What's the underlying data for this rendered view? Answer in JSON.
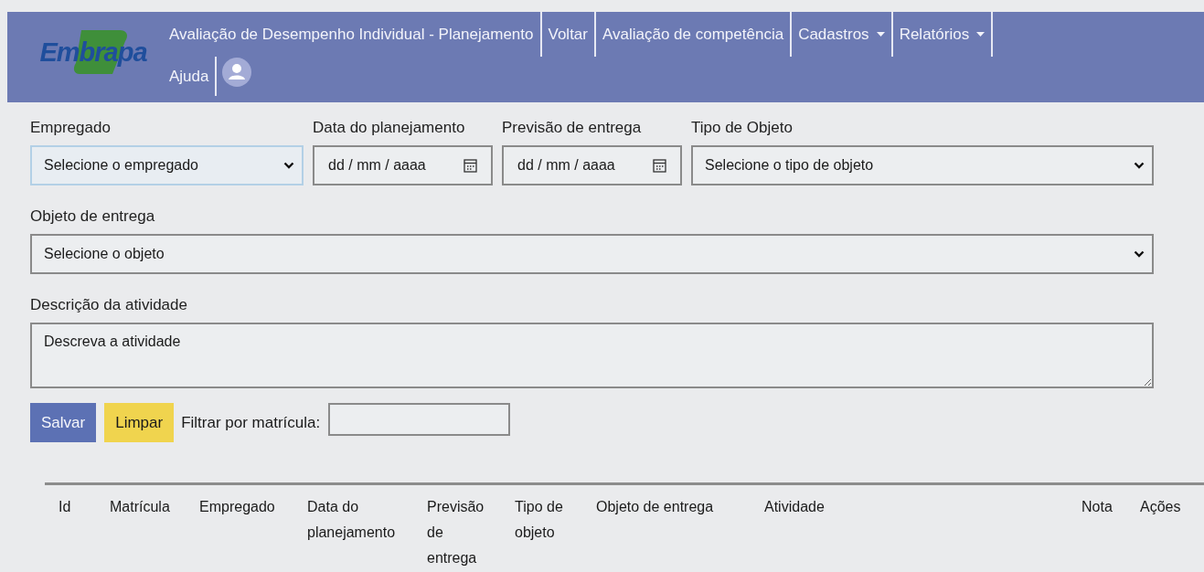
{
  "navbar": {
    "logo": "Embrapa",
    "items": [
      {
        "label": "Avaliação de Desempenho Individual - Planejamento",
        "dropdown": false
      },
      {
        "label": "Voltar",
        "dropdown": false
      },
      {
        "label": "Avaliação de competência",
        "dropdown": false
      },
      {
        "label": "Cadastros",
        "dropdown": true
      },
      {
        "label": "Relatórios",
        "dropdown": true
      },
      {
        "label": "Ajuda",
        "dropdown": false
      }
    ]
  },
  "form": {
    "rows": [
      [
        {
          "kind": "select",
          "label": "Empregado",
          "value": "Selecione o empregado",
          "focused": true
        },
        {
          "kind": "date",
          "label": "Data do planejamento",
          "placeholder": "dd / mm / aaaa",
          "focused": false
        },
        {
          "kind": "date",
          "label": "Previsão de entrega",
          "placeholder": "dd / mm / aaaa",
          "focused": false
        },
        {
          "kind": "select",
          "label": "Tipo de Objeto",
          "value": "Selecione o tipo de objeto",
          "focused": false
        }
      ],
      [
        {
          "kind": "select",
          "label": "Objeto de entrega",
          "value": "Selecione o objeto",
          "focused": false
        }
      ],
      [
        {
          "kind": "textarea",
          "label": "Descrição da atividade",
          "placeholder": "Descreva a atividade",
          "focused": false
        }
      ]
    ],
    "buttons": [
      {
        "label": "Salvar",
        "kind": "primary"
      },
      {
        "label": "Limpar",
        "kind": "warning"
      }
    ],
    "filter": {
      "label": "Filtrar por matrícula:"
    }
  },
  "table": {
    "columns": [
      "Id",
      "Matrícula",
      "Empregado",
      "Data do planejamento",
      "Previsão de entrega",
      "Tipo de objeto",
      "Objeto de entrega",
      "Atividade",
      "Nota",
      "Ações"
    ]
  }
}
